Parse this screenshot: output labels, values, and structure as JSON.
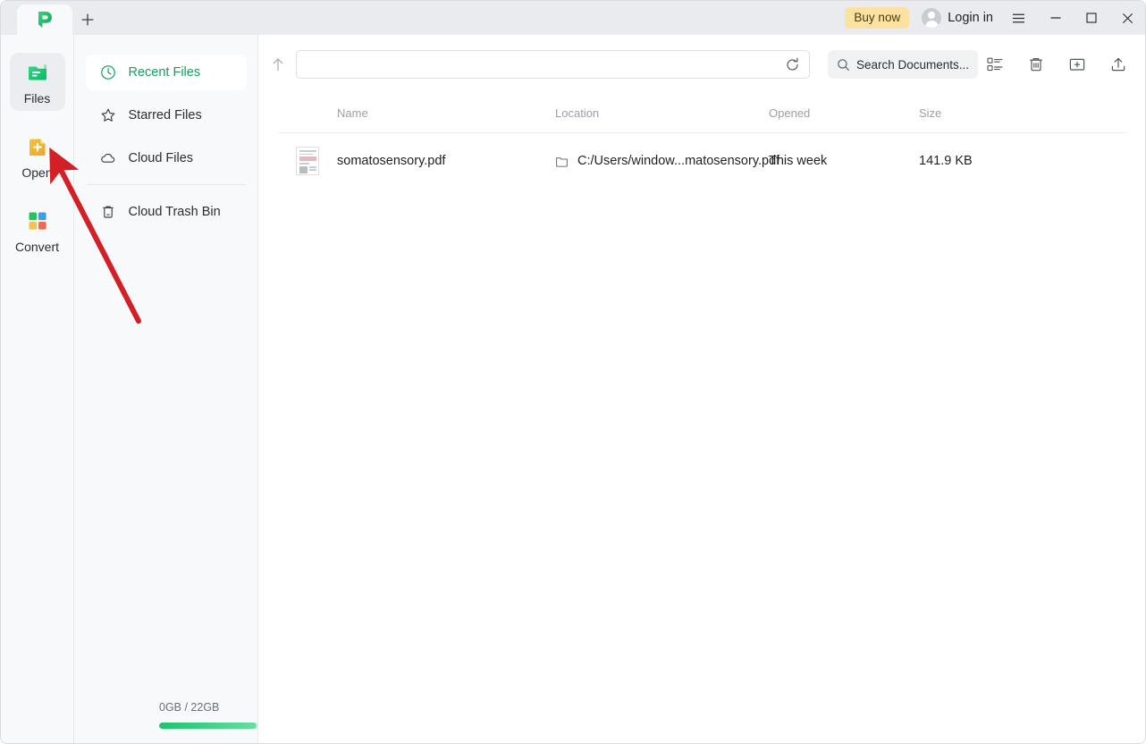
{
  "titlebar": {
    "logo_icon": "pdfelement-logo-icon",
    "new_tab_icon": "plus-icon",
    "buy_now_label": "Buy now",
    "avatar_icon": "user-avatar-icon",
    "login_label": "Login in",
    "menu_icon": "hamburger-menu-icon",
    "minimize_icon": "minimize-icon",
    "maximize_icon": "maximize-icon",
    "close_icon": "close-icon"
  },
  "rail": {
    "items": [
      {
        "label": "Files",
        "icon": "files-folder-icon",
        "active": true
      },
      {
        "label": "Open",
        "icon": "open-file-plus-icon",
        "active": false
      },
      {
        "label": "Convert",
        "icon": "convert-grid-icon",
        "active": false
      }
    ]
  },
  "storage": {
    "text": "0GB / 22GB",
    "used_percent": 60,
    "fill_color": "#1ec26f"
  },
  "nav": {
    "items": [
      {
        "label": "Recent Files",
        "icon": "clock-icon",
        "active": true
      },
      {
        "label": "Starred Files",
        "icon": "star-icon",
        "active": false
      },
      {
        "label": "Cloud Files",
        "icon": "cloud-icon",
        "active": false
      },
      {
        "label": "Cloud Trash Bin",
        "icon": "trash-icon",
        "active": false
      }
    ],
    "divider_after_index": 2,
    "active_color": "#13a05f"
  },
  "toolbar": {
    "up_icon": "arrow-up-icon",
    "address_value": "",
    "address_placeholder": "",
    "refresh_icon": "refresh-icon",
    "search_icon": "search-icon",
    "search_value": "",
    "search_placeholder": "Search Documents...",
    "buttons": [
      {
        "name": "list-view-icon"
      },
      {
        "name": "trash-icon"
      },
      {
        "name": "new-folder-icon"
      },
      {
        "name": "upload-icon"
      }
    ]
  },
  "table": {
    "columns": {
      "name": "Name",
      "location": "Location",
      "opened": "Opened",
      "size": "Size"
    },
    "rows": [
      {
        "thumb_icon": "pdf-thumbnail-icon",
        "name": "somatosensory.pdf",
        "location_icon": "folder-icon",
        "location": "C:/Users/window...matosensory.pdf",
        "opened": "This week",
        "size": "141.9 KB"
      }
    ]
  },
  "annotation": {
    "arrow_color": "#d31f26",
    "points_to": "open-button"
  }
}
